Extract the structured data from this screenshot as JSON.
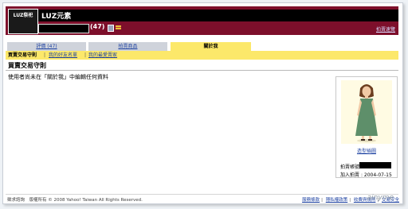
{
  "header": {
    "logo_text_top": "LUZ祭祀",
    "logo_text_bottom": "",
    "store_title": "LUZ元素",
    "score": "(47)",
    "my_auctions_link": "拍賣速覽"
  },
  "tabs": [
    {
      "label": "評價 (47)"
    },
    {
      "label": "拍賣商品"
    },
    {
      "label": "關於我"
    }
  ],
  "subnav": {
    "active": "買賣交易守則",
    "links": [
      "我的好友名單",
      "我的最愛賣家"
    ]
  },
  "content": {
    "section_title": "買賣交易守則",
    "message": "使用者尚未在「關於我」中編輯任何資料"
  },
  "profile": {
    "avatar_link": "造型插圖",
    "id_label": "拍賣帳號",
    "join_label": "加入拍賣",
    "join_date": "2004-07-15"
  },
  "footer": {
    "copyright": "徵求諮詢　版權所有 © 2008 Yahoo! Taiwan All Rights Reserved.",
    "links": [
      "服務條款",
      "隱私權政策",
      "收費與規則",
      "交易安全"
    ]
  },
  "watermark": "ainyme",
  "colors": {
    "header_bg": "#7d0f2b",
    "active_tab": "#fce86a",
    "inactive_tab": "#cfd3db",
    "link": "#1a3fa0"
  }
}
